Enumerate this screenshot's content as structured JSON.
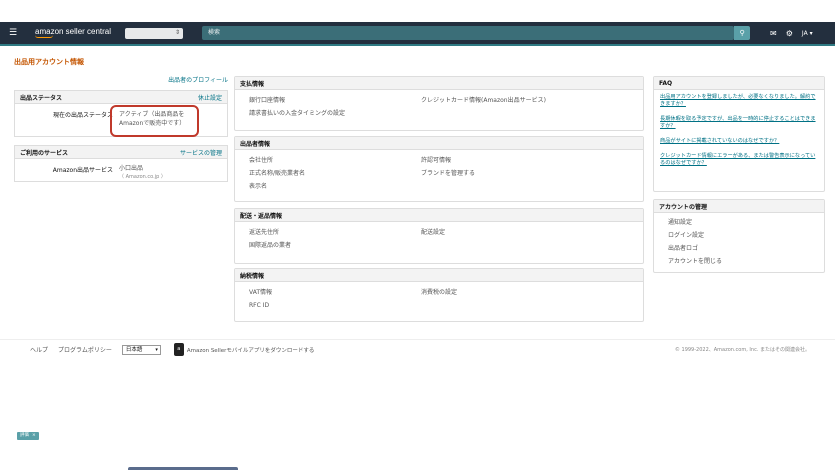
{
  "header": {
    "menu_icon": "hamburger-icon",
    "logo_text": "amazon seller central",
    "search_placeholder": "検索",
    "search_icon": "search-icon",
    "mail_icon": "mail-icon",
    "settings_icon": "gear-icon",
    "language": "JA ▾"
  },
  "page": {
    "title": "出品用アカウント情報"
  },
  "left": {
    "profile_link": "出品者のプロフィール",
    "status": {
      "heading": "出品ステータス",
      "action": "休止設定",
      "label": "現在の出品ステータス",
      "value": "アクティブ（出品商品をAmazonで販売中です）"
    },
    "services": {
      "heading": "ご利用のサービス",
      "action": "サービスの管理",
      "label": "Amazon出品サービス",
      "value": "小口出品",
      "sub": "（ Amazon.co.jp ）"
    }
  },
  "middle": {
    "payment": {
      "heading": "支払情報",
      "items": [
        "銀行口座情報",
        "クレジットカード情報(Amazon出品サービス)",
        "請求書払いの入金タイミングの設定"
      ]
    },
    "seller": {
      "heading": "出品者情報",
      "items": [
        "会社住所",
        "許認可情報",
        "正式名称/販売業者名",
        "ブランドを管理する",
        "表示名"
      ]
    },
    "shipping": {
      "heading": "配送・返品情報",
      "items": [
        "返送先住所",
        "配送設定",
        "国際返品の業者"
      ]
    },
    "tax": {
      "heading": "納税情報",
      "items": [
        "VAT情報",
        "消費税の設定",
        "RFC ID"
      ]
    }
  },
  "right": {
    "faq": {
      "heading": "FAQ",
      "items": [
        "出品用アカウントを登録しましたが、必要なくなりました。解約できますか？",
        "長期休暇を取る予定ですが、出品を一時的に停止することはできますか？",
        "商品がサイトに掲載されていないのはなぜですか？",
        "クレジットカード情報にエラーがある、または警告表示になっているのはなぜですか？"
      ]
    },
    "account": {
      "heading": "アカウントの管理",
      "items": [
        "通知設定",
        "ログイン設定",
        "出品者ロゴ",
        "アカウントを閉じる"
      ]
    }
  },
  "footer": {
    "help": "ヘルプ",
    "policy": "プログラムポリシー",
    "language": "日本語",
    "app_icon": "mobile-app-icon",
    "app_link": "Amazon Sellerモバイルアプリをダウンロードする",
    "copyright": "© 1999-2022、Amazon.com, Inc. またはその関連会社。"
  },
  "tag": {
    "label": "評価",
    "close": "×"
  }
}
